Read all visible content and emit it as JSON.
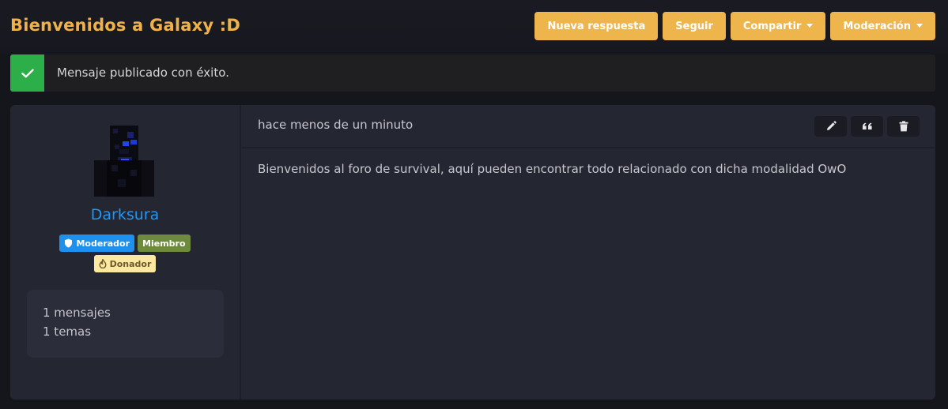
{
  "thread": {
    "title": "Bienvenidos a Galaxy :D",
    "actions": {
      "reply": "Nueva respuesta",
      "follow": "Seguir",
      "share": "Compartir",
      "moderation": "Moderación"
    }
  },
  "alert": {
    "message": "Mensaje publicado con éxito.",
    "icon": "check-icon"
  },
  "post": {
    "author": {
      "username": "Darksura",
      "badges": {
        "moderator": "Moderador",
        "member": "Miembro",
        "donor": "Donador"
      },
      "stats": {
        "messages": "1 mensajes",
        "topics": "1 temas"
      }
    },
    "timestamp": "hace menos de un minuto",
    "tools": [
      "pencil-icon",
      "quote-icon",
      "trash-icon"
    ],
    "body": "Bienvenidos al foro de survival, aquí pueden encontrar todo relacionado con dicha modalidad OwO"
  },
  "colors": {
    "accent": "#eeb54c",
    "success": "#2cae49",
    "username": "#2196f3",
    "background": "#15161c",
    "panel": "#242632"
  }
}
